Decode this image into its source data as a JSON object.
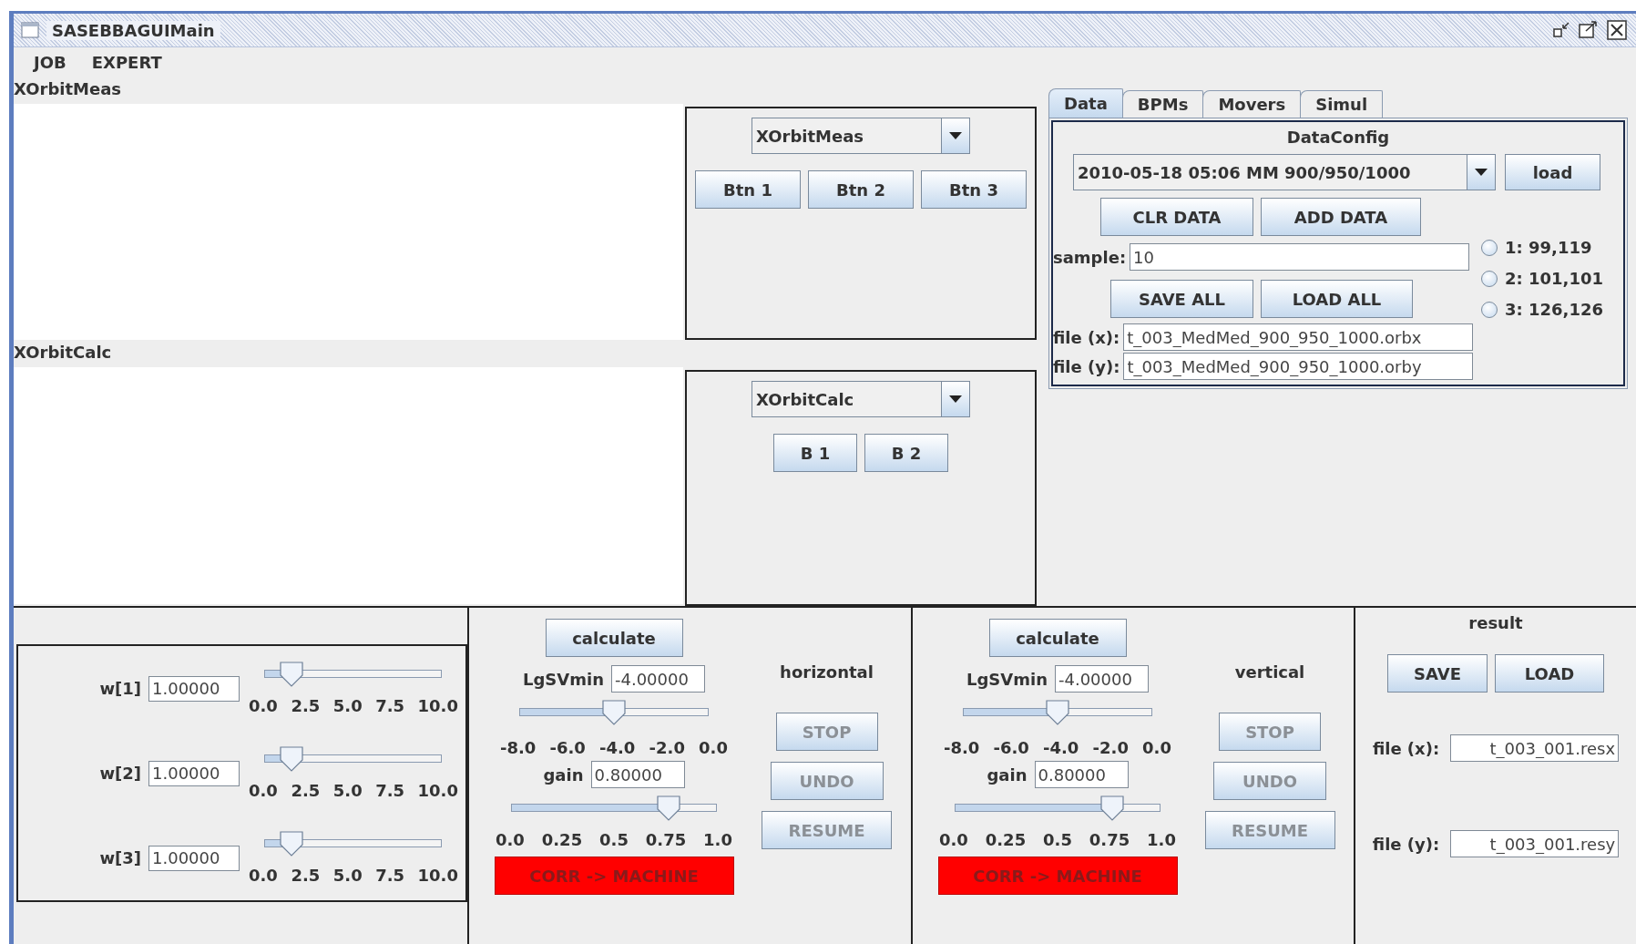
{
  "window": {
    "title": "SASEBBAGUIMain"
  },
  "menu": [
    "JOB",
    "EXPERT"
  ],
  "plots": [
    {
      "title": "XOrbitMeas",
      "selector": "XOrbitMeas",
      "buttons": [
        "Btn 1",
        "Btn 2",
        "Btn 3"
      ]
    },
    {
      "title": "XOrbitCalc",
      "selector": "XOrbitCalc",
      "buttons": [
        "B 1",
        "B 2"
      ]
    }
  ],
  "tabs": [
    {
      "label": "Data",
      "selected": true
    },
    {
      "label": "BPMs",
      "selected": false
    },
    {
      "label": "Movers",
      "selected": false
    },
    {
      "label": "Simul",
      "selected": false
    }
  ],
  "data_config": {
    "title": "DataConfig",
    "dataset": "2010-05-18 05:06 MM 900/950/1000",
    "load_button": "load",
    "buttons_top": [
      "CLR DATA",
      "ADD DATA"
    ],
    "sample_label": "sample:",
    "sample_value": "10",
    "buttons_bottom": [
      "SAVE ALL",
      "LOAD ALL"
    ],
    "files": [
      {
        "label": "file (x):",
        "value": "t_003_MedMed_900_950_1000.orbx"
      },
      {
        "label": "file (y):",
        "value": "t_003_MedMed_900_950_1000.orby"
      }
    ],
    "options": [
      {
        "label": "1: 99,119",
        "selected": false
      },
      {
        "label": "2: 101,101",
        "selected": false
      },
      {
        "label": "3: 126,126",
        "selected": false
      }
    ]
  },
  "weights": [
    {
      "label": "w[1]",
      "value": "1.00000",
      "level": 0.1,
      "ticks": [
        "0.0",
        "2.5",
        "5.0",
        "7.5",
        "10.0"
      ]
    },
    {
      "label": "w[2]",
      "value": "1.00000",
      "level": 0.1,
      "ticks": [
        "0.0",
        "2.5",
        "5.0",
        "7.5",
        "10.0"
      ]
    },
    {
      "label": "w[3]",
      "value": "1.00000",
      "level": 0.1,
      "ticks": [
        "0.0",
        "2.5",
        "5.0",
        "7.5",
        "10.0"
      ]
    }
  ],
  "corrections": [
    {
      "plane": "horizontal",
      "calculate": "calculate",
      "lgsvmin": {
        "label": "LgSVmin",
        "value": "-4.00000",
        "level": 0.5,
        "ticks": [
          "-8.0",
          "-6.0",
          "-4.0",
          "-2.0",
          "0.0"
        ]
      },
      "gain": {
        "label": "gain",
        "value": "0.80000",
        "level": 0.8,
        "ticks": [
          "0.0",
          "0.25",
          "0.5",
          "0.75",
          "1.0"
        ]
      },
      "buttons": [
        {
          "label": "STOP",
          "disabled": true
        },
        {
          "label": "UNDO",
          "disabled": true
        },
        {
          "label": "RESUME",
          "disabled": true
        }
      ],
      "corr_button": {
        "label": "CORR -> MACHINE",
        "disabled": true
      }
    },
    {
      "plane": "vertical",
      "calculate": "calculate",
      "lgsvmin": {
        "label": "LgSVmin",
        "value": "-4.00000",
        "level": 0.5,
        "ticks": [
          "-8.0",
          "-6.0",
          "-4.0",
          "-2.0",
          "0.0"
        ]
      },
      "gain": {
        "label": "gain",
        "value": "0.80000",
        "level": 0.8,
        "ticks": [
          "0.0",
          "0.25",
          "0.5",
          "0.75",
          "1.0"
        ]
      },
      "buttons": [
        {
          "label": "STOP",
          "disabled": true
        },
        {
          "label": "UNDO",
          "disabled": true
        },
        {
          "label": "RESUME",
          "disabled": true
        }
      ],
      "corr_button": {
        "label": "CORR -> MACHINE",
        "disabled": true
      }
    }
  ],
  "result": {
    "title": "result",
    "buttons": [
      "SAVE",
      "LOAD"
    ],
    "files": [
      {
        "label": "file (x):",
        "value": "t_003_001.resx"
      },
      {
        "label": "file (y):",
        "value": "t_003_001.resy"
      }
    ]
  }
}
